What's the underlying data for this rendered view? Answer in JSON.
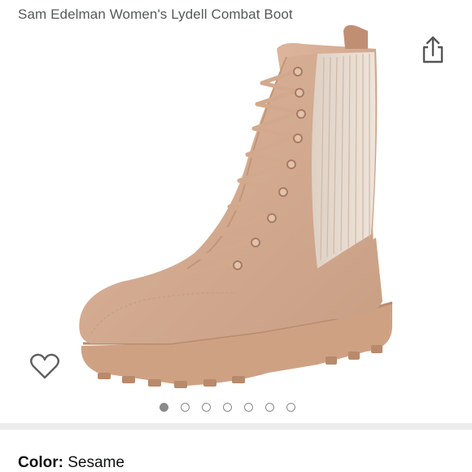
{
  "product": {
    "title": "Sam Edelman Women's Lydell Combat Boot"
  },
  "icons": {
    "share": "share-icon",
    "wishlist": "heart-outline-icon"
  },
  "carousel": {
    "total": 7,
    "active_index": 0
  },
  "color": {
    "label": "Color:",
    "value": "Sesame"
  },
  "colors": {
    "suede": "#d7ae95",
    "sole": "#cfa183",
    "knit": "#e6d5c8",
    "dot_active": "#8a8a8a",
    "title_text": "#565959"
  }
}
